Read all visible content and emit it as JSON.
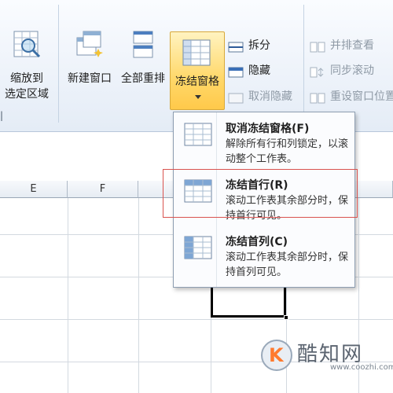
{
  "ribbon": {
    "zoom_selection_line1": "缩放到",
    "zoom_selection_line2": "选定区域",
    "new_window": "新建窗口",
    "arrange_all": "全部重排",
    "freeze_panes": "冻结窗格",
    "split": "拆分",
    "hide": "隐藏",
    "unhide": "取消隐藏",
    "view_side_by_side": "并排查看",
    "synchronous_scrolling": "同步滚动",
    "reset_window_position": "重设窗口位置"
  },
  "grid": {
    "columns": [
      "E",
      "F"
    ]
  },
  "dropdown": {
    "items": [
      {
        "title": "取消冻结窗格(F)",
        "desc": "解除所有行和列锁定，以滚动整个工作表。"
      },
      {
        "title": "冻结首行(R)",
        "desc": "滚动工作表其余部分时，保持首行可见。"
      },
      {
        "title": "冻结首列(C)",
        "desc": "滚动工作表其余部分时，保持首列可见。"
      }
    ]
  },
  "watermark": {
    "title": "酷知网",
    "url": "www.coozhi.com"
  },
  "colors": {
    "accent_highlight": "#ffd86a",
    "annotation_red": "#d9534f",
    "watermark_k": "#ff7a2e"
  }
}
